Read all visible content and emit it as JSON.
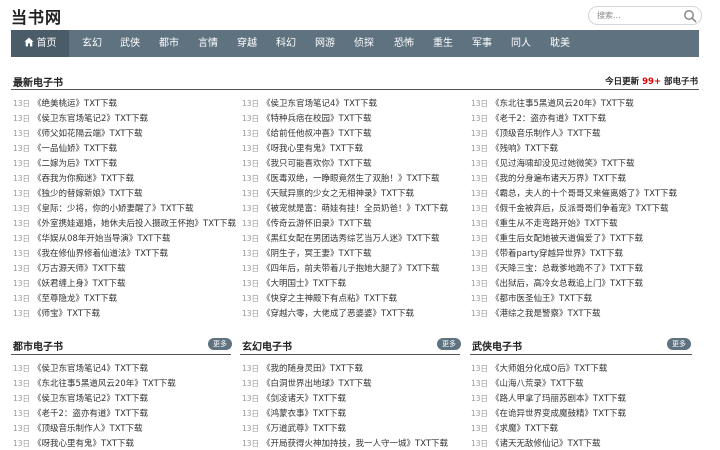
{
  "site": {
    "logo": "当书网"
  },
  "search": {
    "placeholder": "搜索..."
  },
  "nav": [
    {
      "label": "首页"
    },
    {
      "label": "玄幻"
    },
    {
      "label": "武侠"
    },
    {
      "label": "都市"
    },
    {
      "label": "言情"
    },
    {
      "label": "穿越"
    },
    {
      "label": "科幻"
    },
    {
      "label": "网游"
    },
    {
      "label": "侦探"
    },
    {
      "label": "恐怖"
    },
    {
      "label": "重生"
    },
    {
      "label": "军事"
    },
    {
      "label": "同人"
    },
    {
      "label": "耽美"
    }
  ],
  "latest": {
    "title": "最新电子书",
    "update_prefix": "今日更新",
    "update_count": "99+",
    "update_suffix": "部电子书",
    "columns": [
      [
        {
          "date": "13日",
          "title": "《绝美桃运》TXT下载"
        },
        {
          "date": "13日",
          "title": "《侯卫东官场笔记2》TXT下载"
        },
        {
          "date": "13日",
          "title": "《师父如花隔云端》TXT下载"
        },
        {
          "date": "13日",
          "title": "《一品仙娇》TXT下载"
        },
        {
          "date": "13日",
          "title": "《二嫁为后》TXT下载"
        },
        {
          "date": "13日",
          "title": "《吞我为你痴迷》TXT下载"
        },
        {
          "date": "13日",
          "title": "《独少的替嫁新娘》TXT下载"
        },
        {
          "date": "13日",
          "title": "《皇际：少将，你的小娇妻醒了》TXT下载"
        },
        {
          "date": "13日",
          "title": "《外室携娃逼婚，她休夫后投入摄政王怀抱》TXT下载"
        },
        {
          "date": "13日",
          "title": "《华娱从08年开始当导演》TXT下载"
        },
        {
          "date": "13日",
          "title": "《我在修仙界修着仙道法》TXT下载"
        },
        {
          "date": "13日",
          "title": "《万古源天师》TXT下载"
        },
        {
          "date": "13日",
          "title": "《妖君缠上身》TXT下载"
        },
        {
          "date": "13日",
          "title": "《至尊隐龙》TXT下载"
        },
        {
          "date": "13日",
          "title": "《师宝》TXT下载"
        }
      ],
      [
        {
          "date": "13日",
          "title": "《侯卫东官场笔记4》TXT下载"
        },
        {
          "date": "13日",
          "title": "《特种兵痞在校园》TXT下载"
        },
        {
          "date": "13日",
          "title": "《给前任他叔冲喜》TXT下载"
        },
        {
          "date": "13日",
          "title": "《呀我心里有鬼》TXT下载"
        },
        {
          "date": "13日",
          "title": "《我只可能喜欢你》TXT下载"
        },
        {
          "date": "13日",
          "title": "《医毒双绝，一睁眼竟然生了双胎！》TXT下载"
        },
        {
          "date": "13日",
          "title": "《天赋异禀的少女之无相神录》TXT下载"
        },
        {
          "date": "13日",
          "title": "《被宠就是富：萌娃有挂！全员奶爸！》TXT下载"
        },
        {
          "date": "13日",
          "title": "《传奇云游怀旧录》TXT下载"
        },
        {
          "date": "13日",
          "title": "《黑红女配在男团选秀综艺当万人迷》TXT下载"
        },
        {
          "date": "13日",
          "title": "《阴生子，冥王妻》TXT下载"
        },
        {
          "date": "13日",
          "title": "《四年后，前夫带着儿子抱她大腿了》TXT下载"
        },
        {
          "date": "13日",
          "title": "《大明国士》TXT下载"
        },
        {
          "date": "13日",
          "title": "《快穿之主神殿下有点粘》TXT下载"
        },
        {
          "date": "13日",
          "title": "《穿越六零，大佬成了恶婆婆》TXT下载"
        }
      ],
      [
        {
          "date": "13日",
          "title": "《东北往事5黑道风云20年》TXT下载"
        },
        {
          "date": "13日",
          "title": "《老千2：盗亦有道》TXT下载"
        },
        {
          "date": "13日",
          "title": "《顶级音乐制作人》TXT下载"
        },
        {
          "date": "13日",
          "title": "《残响》TXT下载"
        },
        {
          "date": "13日",
          "title": "《见过海啸却没见过她微笑》TXT下载"
        },
        {
          "date": "13日",
          "title": "《我的分身遍布诸天万界》TXT下载"
        },
        {
          "date": "13日",
          "title": "《霸总，夫人的十个哥哥又来催离婚了》TXT下载"
        },
        {
          "date": "13日",
          "title": "《假千金被弃后，反派哥哥们争着宠》TXT下载"
        },
        {
          "date": "13日",
          "title": "《重生从不走弯路开始》TXT下载"
        },
        {
          "date": "13日",
          "title": "《重生后女配她被天道偏爱了》TXT下载"
        },
        {
          "date": "13日",
          "title": "《带着party穿越异世界》TXT下载"
        },
        {
          "date": "13日",
          "title": "《天降三宝：总裁爹地跪不了》TXT下载"
        },
        {
          "date": "13日",
          "title": "《出狱后，高冷女总裁追上门》TXT下载"
        },
        {
          "date": "13日",
          "title": "《都市医圣仙王》TXT下载"
        },
        {
          "date": "13日",
          "title": "《港综之我是警察》TXT下载"
        }
      ]
    ]
  },
  "categories": [
    {
      "title": "都市电子书",
      "more": "更多",
      "items": [
        {
          "date": "13日",
          "title": "《侯卫东官场笔记4》TXT下载"
        },
        {
          "date": "13日",
          "title": "《东北往事5黑道风云20年》TXT下载"
        },
        {
          "date": "13日",
          "title": "《侯卫东官场笔记2》TXT下载"
        },
        {
          "date": "13日",
          "title": "《老千2：盗亦有道》TXT下载"
        },
        {
          "date": "13日",
          "title": "《顶级音乐制作人》TXT下载"
        },
        {
          "date": "13日",
          "title": "《呀我心里有鬼》TXT下载"
        }
      ]
    },
    {
      "title": "玄幻电子书",
      "more": "更多",
      "items": [
        {
          "date": "13日",
          "title": "《我的随身灵田》TXT下载"
        },
        {
          "date": "13日",
          "title": "《白洞世界出地球》TXT下载"
        },
        {
          "date": "13日",
          "title": "《剑凌诸天》TXT下载"
        },
        {
          "date": "13日",
          "title": "《鸿蒙衣事》TXT下载"
        },
        {
          "date": "13日",
          "title": "《万道武尊》TXT下载"
        },
        {
          "date": "13日",
          "title": "《开局获得火神加持技，我一人守一城》TXT下载"
        }
      ]
    },
    {
      "title": "武侠电子书",
      "more": "更多",
      "items": [
        {
          "date": "13日",
          "title": "《大师姐分化成O后》TXT下载"
        },
        {
          "date": "13日",
          "title": "《山海八荒录》TXT下载"
        },
        {
          "date": "13日",
          "title": "《路人甲拿了玛丽苏剧本》TXT下载"
        },
        {
          "date": "13日",
          "title": "《在诡异世界变成魔鼓精》TXT下载"
        },
        {
          "date": "13日",
          "title": "《求魔》TXT下载"
        },
        {
          "date": "13日",
          "title": "《诸天无敌修仙记》TXT下载"
        }
      ]
    }
  ],
  "colors": {
    "nav_bg": "#5f7280",
    "nav_active": "#4a5c68",
    "accent_red": "#e00000"
  },
  "icons": {
    "search": "search-icon",
    "home": "home-icon"
  }
}
